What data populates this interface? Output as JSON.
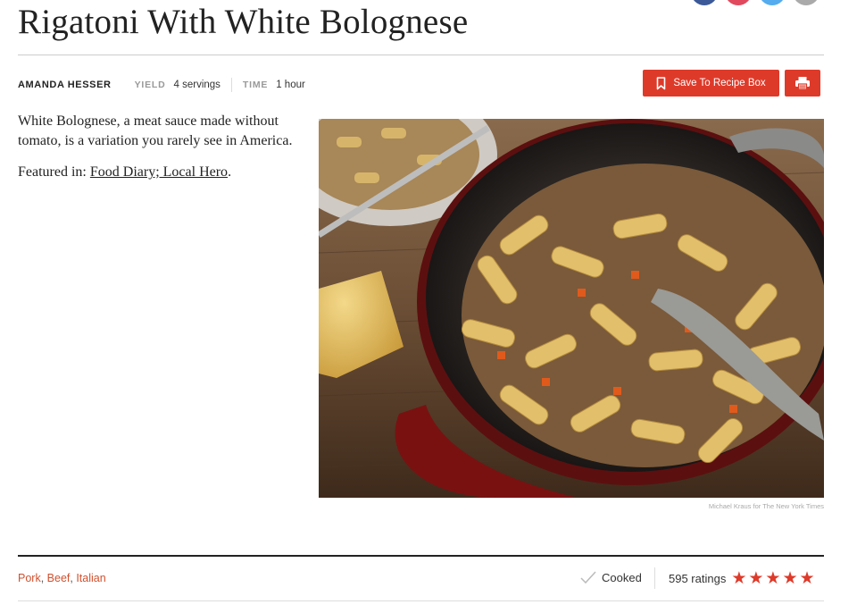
{
  "recipe": {
    "title": "Rigatoni With White Bolognese",
    "author": "AMANDA HESSER",
    "yield_label": "YIELD",
    "yield_value": "4 servings",
    "time_label": "TIME",
    "time_value": "1 hour"
  },
  "actions": {
    "save_label": "Save To Recipe Box",
    "print_icon": "print-icon",
    "save_icon": "bookmark-icon"
  },
  "share": {
    "buttons": [
      {
        "icon": "facebook-icon",
        "color": "#3b5998"
      },
      {
        "icon": "pinterest-icon",
        "color": "#e0495e"
      },
      {
        "icon": "twitter-icon",
        "color": "#55acee"
      },
      {
        "icon": "email-icon",
        "color": "#aaaaaa"
      }
    ]
  },
  "intro": {
    "description": "White Bolognese, a meat sauce made without tomato, is a variation you rarely see in America.",
    "featured_prefix": "Featured in: ",
    "featured_link": "Food Diary; Local Hero",
    "featured_suffix": "."
  },
  "photo": {
    "credit": "Michael Kraus for The New York Times"
  },
  "footer": {
    "tags": [
      "Pork",
      "Beef",
      "Italian"
    ],
    "tag_separator": ", ",
    "cooked_label": "Cooked",
    "ratings_label": "595 ratings",
    "star_count": 5,
    "star_glyph": "★"
  },
  "colors": {
    "accent": "#de3a2a",
    "tag": "#d0512f"
  }
}
